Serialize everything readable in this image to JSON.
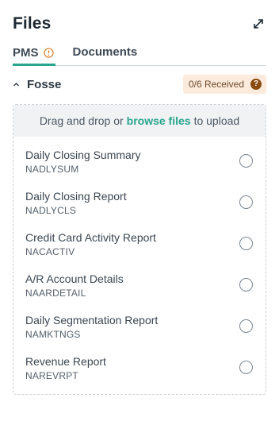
{
  "header": {
    "title": "Files",
    "expand_icon": "expand-arrows-icon"
  },
  "tabs": [
    {
      "label": "PMS",
      "active": true,
      "icon": "warning-circle-icon"
    },
    {
      "label": "Documents",
      "active": false
    }
  ],
  "group": {
    "name": "Fosse",
    "collapse_icon": "chevron-up-icon",
    "status": "0/6 Received",
    "help_glyph": "?"
  },
  "dropzone": {
    "text_before": "Drag and drop or",
    "link_text": "browse files",
    "text_after": "to upload"
  },
  "files": [
    {
      "name": "Daily Closing Summary",
      "code": "NADLYSUM"
    },
    {
      "name": "Daily Closing Report",
      "code": "NADLYCLS"
    },
    {
      "name": "Credit Card Activity Report",
      "code": "NACACTIV"
    },
    {
      "name": "A/R Account Details",
      "code": "NAARDETAIL"
    },
    {
      "name": "Daily Segmentation Report",
      "code": "NAMKTNGS"
    },
    {
      "name": "Revenue Report",
      "code": "NAREVRPT"
    }
  ],
  "colors": {
    "accent": "#2aa58f",
    "warning": "#d9822b",
    "badge_bg": "#fcebdc",
    "help_bg": "#8a4b12"
  }
}
